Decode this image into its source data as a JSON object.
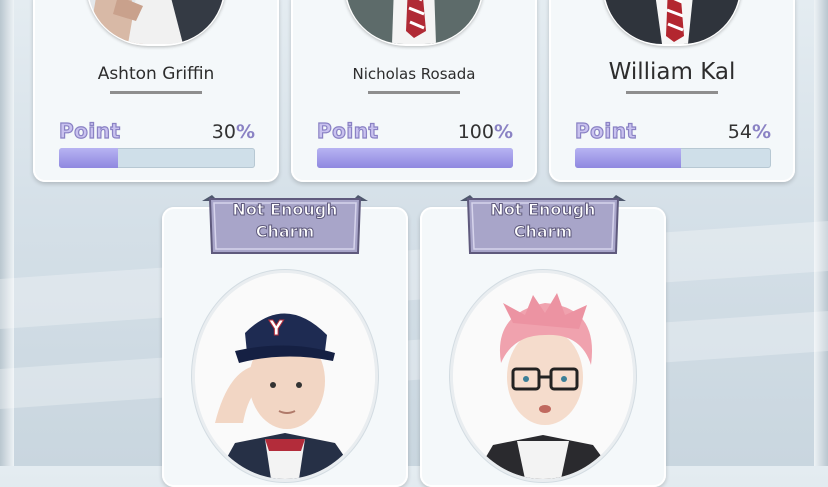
{
  "characters_top": [
    {
      "name": "Ashton Griffin",
      "point_label": "Point",
      "point_value": "30",
      "percent_sign": "%",
      "progress": 0.3
    },
    {
      "name": "Nicholas Rosada",
      "point_label": "Point",
      "point_value": "100",
      "percent_sign": "%",
      "progress": 1.0
    },
    {
      "name": "William Kal",
      "point_label": "Point",
      "point_value": "54",
      "percent_sign": "%",
      "progress": 0.54
    }
  ],
  "characters_bottom": [
    {
      "status_line1": "Not Enough",
      "status_line2": "Charm",
      "portrait": "boy-with-y-cap"
    },
    {
      "status_line1": "Not Enough",
      "status_line2": "Charm",
      "portrait": "pink-hair-glasses-boy"
    }
  ],
  "colors": {
    "bar_fill": "#9f99e8",
    "point_text": "#c9c2ef",
    "ribbon": "#a8a5c9"
  }
}
